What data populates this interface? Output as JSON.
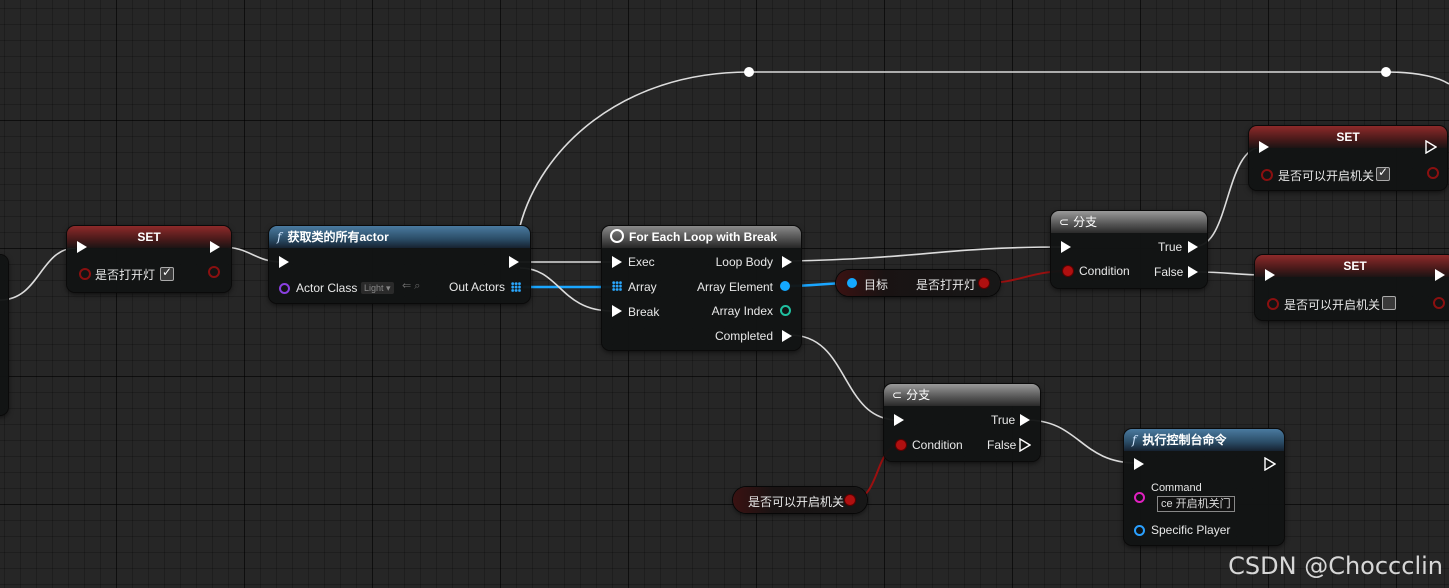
{
  "nodes": {
    "set_light": {
      "title": "SET",
      "var": "是否打开灯",
      "checked": true
    },
    "get_all_actors": {
      "title": "获取类的所有actor",
      "actor_class_label": "Actor Class",
      "actor_class_value": "Light",
      "out_actors": "Out Actors"
    },
    "foreach": {
      "title": "For Each Loop with Break",
      "exec": "Exec",
      "array": "Array",
      "break": "Break",
      "loop_body": "Loop Body",
      "array_element": "Array Element",
      "array_index": "Array Index",
      "completed": "Completed"
    },
    "getter_target": {
      "target": "目标",
      "var": "是否打开灯"
    },
    "branch_top": {
      "title": "分支",
      "condition": "Condition",
      "true": "True",
      "false": "False"
    },
    "set_top_true": {
      "title": "SET",
      "var": "是否可以开启机关",
      "checked": true
    },
    "set_top_false": {
      "title": "SET",
      "var": "是否可以开启机关",
      "checked": false
    },
    "branch_bottom": {
      "title": "分支",
      "condition": "Condition",
      "true": "True",
      "false": "False"
    },
    "getter_switch": {
      "var": "是否可以开启机关"
    },
    "exec_console": {
      "title": "执行控制台命令",
      "command_label": "Command",
      "command_value": "ce 开启机关门",
      "player_label": "Specific Player"
    }
  },
  "watermark": "CSDN @Choccclin",
  "colors": {
    "exec": "#ffffff",
    "bool": "#b01010",
    "object": "#14a8ff",
    "set_header": "#8e2a2a",
    "func_header": "#4a7aa0"
  }
}
